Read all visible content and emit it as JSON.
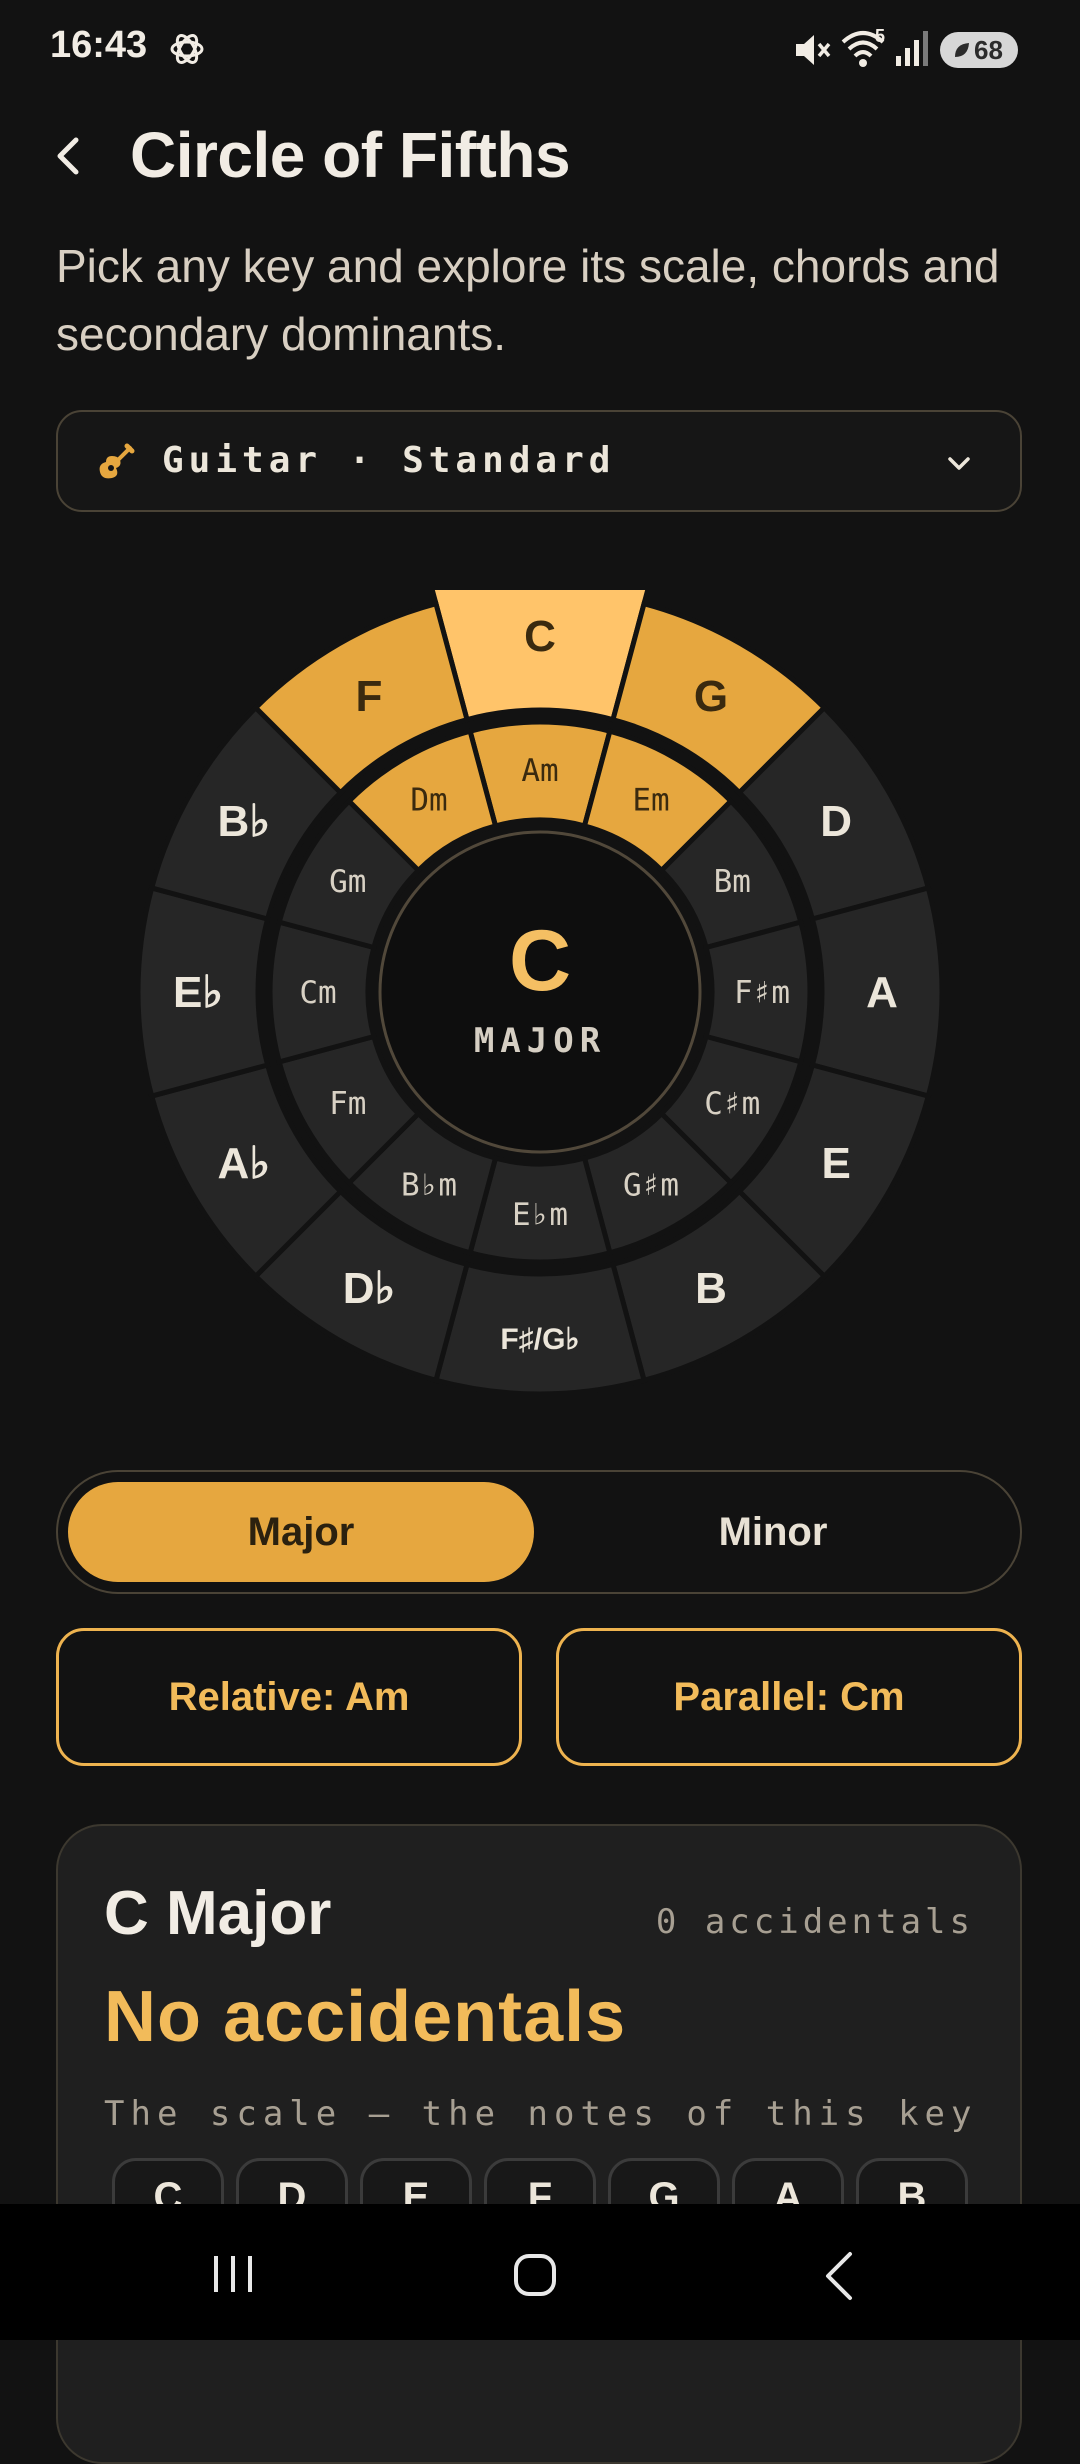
{
  "status_bar": {
    "time": "16:43",
    "wifi_badge": "5",
    "battery": "68",
    "icons": [
      "app-status-icon",
      "mute-icon",
      "wifi-icon",
      "signal-icon",
      "battery-icon"
    ]
  },
  "header": {
    "title": "Circle of Fifths",
    "subtitle": "Pick any key and explore its scale, chords and secondary dominants."
  },
  "instrument": {
    "label": "Guitar · Standard"
  },
  "circle": {
    "selected_index": 0,
    "highlight_indices": [
      11,
      0,
      1
    ],
    "outer": [
      "C",
      "G",
      "D",
      "A",
      "E",
      "B",
      "F♯/G♭",
      "D♭",
      "A♭",
      "E♭",
      "B♭",
      "F"
    ],
    "inner": [
      "Am",
      "Em",
      "Bm",
      "F♯m",
      "C♯m",
      "G♯m",
      "E♭m",
      "B♭m",
      "Fm",
      "Cm",
      "Gm",
      "Dm"
    ],
    "center_key": "C",
    "center_mode": "MAJOR"
  },
  "mode_toggle": {
    "major": "Major",
    "minor": "Minor",
    "selected": "Major"
  },
  "related": {
    "relative": "Relative: Am",
    "parallel": "Parallel: Cm"
  },
  "key_card": {
    "name": "C Major",
    "accidentals_count": "0 accidentals",
    "headline": "No accidentals",
    "scale_caption": "The scale — the notes of this key",
    "notes": [
      "C",
      "D",
      "E",
      "F",
      "G",
      "A",
      "B"
    ]
  },
  "colors": {
    "accent": "#e6a73f",
    "accent_light": "#ffc46a",
    "background": "#121212",
    "segment": "#262626"
  }
}
